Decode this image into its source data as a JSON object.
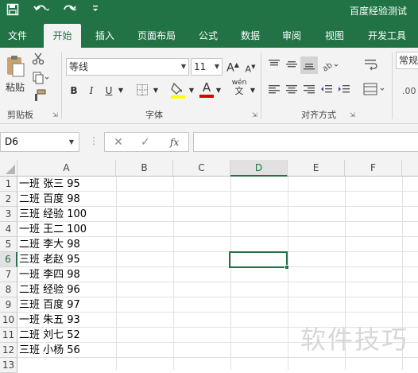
{
  "titlebar": {
    "title": "百度经验测试",
    "save_icon": "save-icon",
    "undo_icon": "undo-icon",
    "redo_icon": "redo-icon",
    "customize_icon": "customize-qat-icon"
  },
  "tabs": [
    "文件",
    "开始",
    "插入",
    "页面布局",
    "公式",
    "数据",
    "审阅",
    "视图",
    "开发工具"
  ],
  "active_tab": "开始",
  "ribbon": {
    "clipboard": {
      "paste": "粘贴",
      "label": "剪贴板"
    },
    "font": {
      "name": "等线",
      "size": "11",
      "grow": "A",
      "shrink": "A",
      "bold": "B",
      "italic": "I",
      "underline": "U",
      "font_color": "A",
      "wen": "wén",
      "label": "字体"
    },
    "alignment": {
      "label": "对齐方式"
    },
    "number": {
      "format": "常规"
    }
  },
  "formula_bar": {
    "name_box": "D6",
    "fx": "fx",
    "cancel": "✕",
    "enter": "✓",
    "value": ""
  },
  "columns": [
    "A",
    "B",
    "C",
    "D",
    "E",
    "F"
  ],
  "rows": [
    "1",
    "2",
    "3",
    "4",
    "5",
    "6",
    "7",
    "8",
    "9",
    "10",
    "11",
    "12",
    "13"
  ],
  "cells_A": [
    "一班 张三 95",
    "二班 百度 98",
    "三班 经验 100",
    "一班 王二 100",
    "二班 李大 98",
    "三班 老赵 95",
    "一班 李四 98",
    "二班 经验 96",
    "三班 百度 97",
    "一班 朱五 93",
    "二班 刘七 52",
    "三班 小杨 56"
  ],
  "selected_cell": "D6",
  "watermark": "软件技巧",
  "colors": {
    "accent": "#217346",
    "ribbon_bg": "#f3f3f3",
    "gridline": "#e1e1e1"
  }
}
